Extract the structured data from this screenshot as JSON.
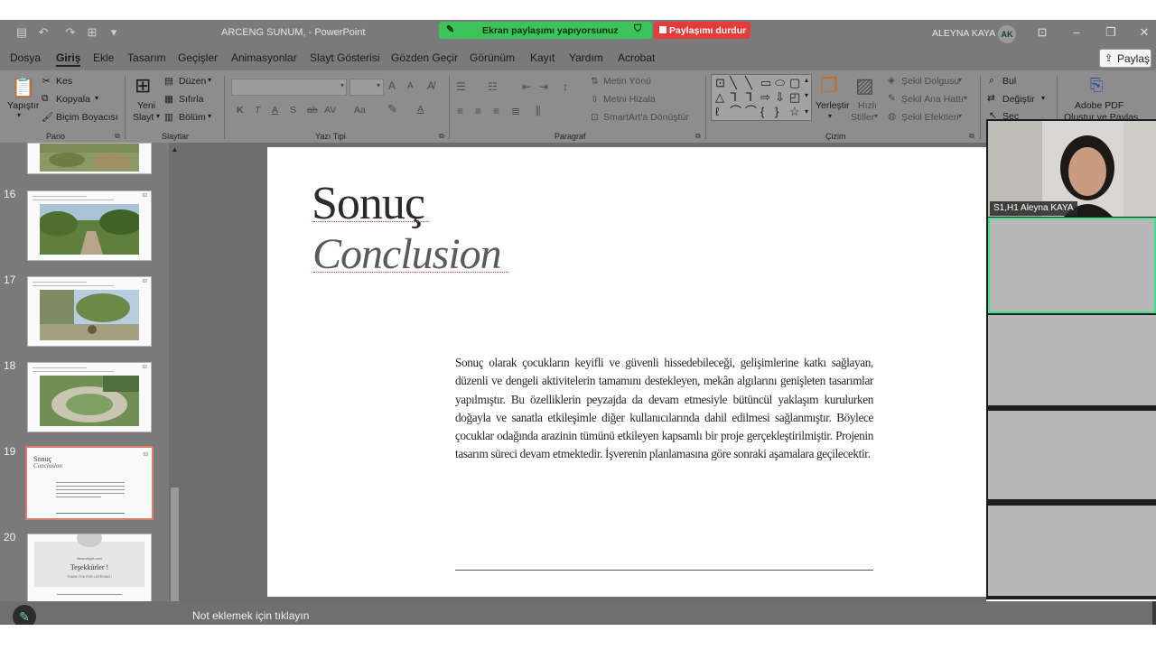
{
  "titlebar": {
    "doc_title": "ARCENG SUNUM,  -  PowerPoint",
    "screen_share_text": "Ekran paylaşımı yapıyorsunuz",
    "stop_share_label": "Paylaşımı durdur",
    "user_name": "ALEYNA KAYA",
    "user_initials": "AK"
  },
  "menu": {
    "tabs": [
      "Dosya",
      "Giriş",
      "Ekle",
      "Tasarım",
      "Geçişler",
      "Animasyonlar",
      "Slayt Gösterisi",
      "Gözden Geçir",
      "Görünüm",
      "Kayıt",
      "Yardım",
      "Acrobat"
    ],
    "active_tab": "Giriş",
    "share_label": "Paylaş"
  },
  "ribbon": {
    "pano": {
      "paste": "Yapıştır",
      "cut": "Kes",
      "copy": "Kopyala",
      "format_painter": "Biçim Boyacısı",
      "label": "Pano"
    },
    "slaytlar": {
      "new_slide_1": "Yeni",
      "new_slide_2": "Slayt",
      "layout": "Düzen",
      "reset": "Sıfırla",
      "section": "Bölüm",
      "label": "Slaytlar"
    },
    "yazi_tipi": {
      "bold": "K",
      "italic": "T",
      "underline": "A",
      "shadow": "S",
      "strike": "ab",
      "spacing": "AV",
      "case": "Aa",
      "grow": "A",
      "shrink": "A",
      "label": "Yazı Tipi"
    },
    "paragraf": {
      "text_direction": "Metin Yönü",
      "align_text": "Metni Hizala",
      "smartart": "SmartArt'a Dönüştür",
      "label": "Paragraf"
    },
    "cizim": {
      "arrange": "Yerleştir",
      "quick_styles_1": "Hızlı",
      "quick_styles_2": "Stiller",
      "shape_fill": "Şekil Dolgusu",
      "shape_outline": "Şekil Ana Hattı",
      "shape_effects": "Şekil Efektleri",
      "label": "Çizim"
    },
    "duzenleme": {
      "find": "Bul",
      "replace": "Değiştir",
      "select": "Seç"
    },
    "adobe": {
      "line1": "Adobe PDF",
      "line2": "Oluştur ve Paylaş"
    }
  },
  "thumbnails": [
    {
      "num": "16",
      "badge": "02"
    },
    {
      "num": "17",
      "badge": "02"
    },
    {
      "num": "18",
      "badge": "02"
    },
    {
      "num": "19",
      "badge": "03",
      "title": "Sonuç",
      "subtitle": "Conclusion"
    },
    {
      "num": "20",
      "title": "Teşekkürler !",
      "caption": "THANK YOU FOR LISTENING !",
      "site": "lifeandlight.com"
    }
  ],
  "slide": {
    "title": "Sonuç",
    "subtitle": "Conclusion",
    "body": "Sonuç olarak çocukların keyifli ve güvenli hissedebileceği, gelişimlerine katkı sağlayan, düzenli ve dengeli aktivitelerin tamamını destekleyen, mekân algılarını genişleten tasarımlar yapılmıştır. Bu özelliklerin peyzajda da devam etmesiyle bütüncül yaklaşım kurulurken doğayla ve sanatla etkileşimle diğer kullanıcılarında dahil edilmesi sağlanmıştır. Böylece çocuklar odağında arazinin tümünü etkileyen kapsamlı bir proje gerçekleştirilmiştir. Projenin tasarım süreci devam etmektedir. İşverenin planlamasına göre sonraki aşamalara geçilecektir."
  },
  "notes": {
    "placeholder": "Not eklemek için tıklayın"
  },
  "video": {
    "participant_name": "S1,H1 Aleyna KAYA"
  },
  "colors": {
    "share_green": "#3cc35a",
    "stop_red": "#e43b3b",
    "active_tile": "#3ee08a"
  }
}
